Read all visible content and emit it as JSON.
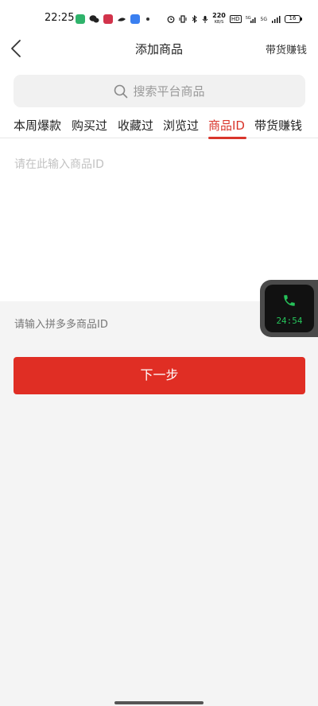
{
  "status_bar": {
    "time": "22:25",
    "network_speed": "220",
    "network_speed_unit": "KB/S",
    "hd_badge": "HD",
    "signal_label": "5G",
    "battery": "16"
  },
  "header": {
    "title": "添加商品",
    "right_link": "带货赚钱"
  },
  "search": {
    "placeholder": "搜索平台商品"
  },
  "tabs": [
    {
      "label": "本周爆款",
      "active": false
    },
    {
      "label": "购买过",
      "active": false
    },
    {
      "label": "收藏过",
      "active": false
    },
    {
      "label": "浏览过",
      "active": false
    },
    {
      "label": "商品ID",
      "active": true
    },
    {
      "label": "带货赚钱",
      "active": false
    }
  ],
  "id_input": {
    "placeholder": "请在此输入商品ID",
    "value": ""
  },
  "hint": "请输入拼多多商品ID",
  "next_button": "下一步",
  "call_widget": {
    "timer": "24:54"
  },
  "colors": {
    "accent": "#e02e24",
    "active_tab": "#d9352b",
    "call_green": "#26c25a"
  }
}
